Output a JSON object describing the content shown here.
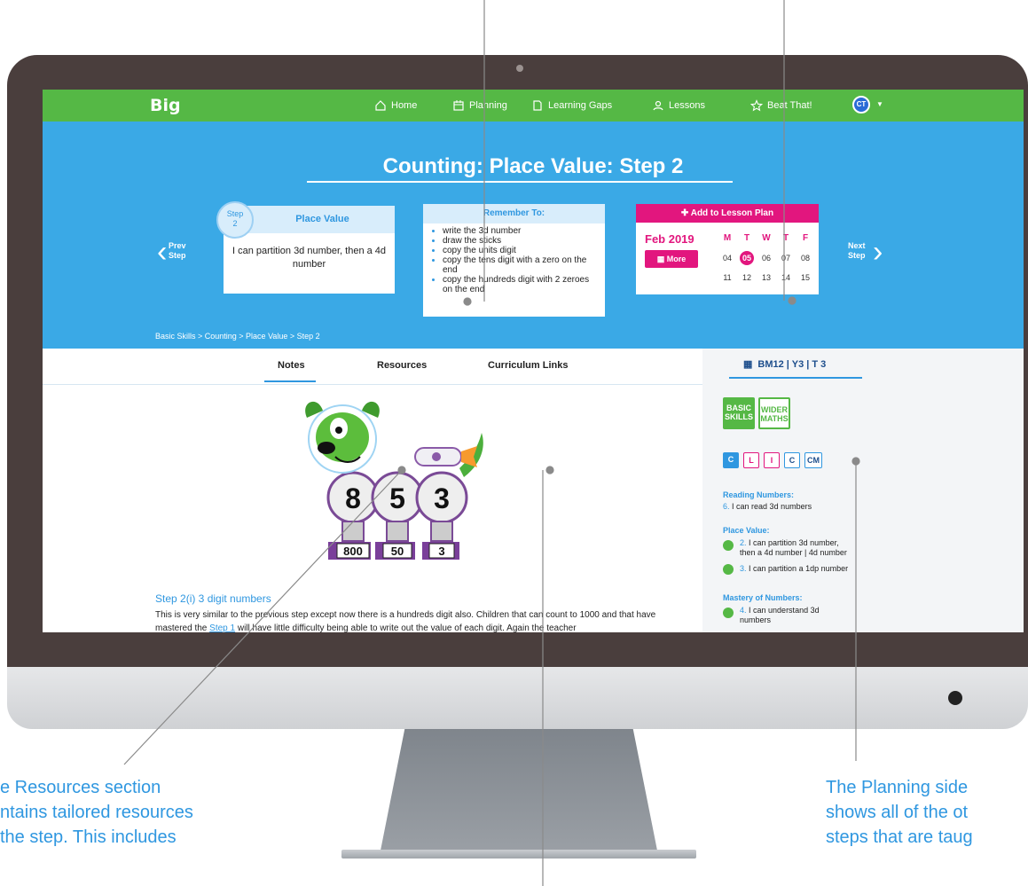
{
  "nav": {
    "logo": "Big",
    "items": [
      {
        "label": "Home",
        "icon": "home-icon"
      },
      {
        "label": "Planning",
        "icon": "calendar-icon"
      },
      {
        "label": "Learning Gaps",
        "icon": "gap-icon"
      },
      {
        "label": "Lessons",
        "icon": "user-icon"
      },
      {
        "label": "Beat That!",
        "icon": "star-icon"
      }
    ],
    "avatar": "CT"
  },
  "hero": {
    "title": "Counting: Place Value: Step 2",
    "step_card": {
      "badge_top": "Step",
      "badge_num": "2",
      "title": "Place Value",
      "text": "I can partition 3d number, then a 4d number"
    },
    "remember": {
      "title": "Remember To:",
      "items": [
        "write the 3d number",
        "draw the sticks",
        "copy the units digit",
        "copy the tens digit with a zero on the end",
        "copy the hundreds digit with 2 zeroes on the end"
      ]
    },
    "lesson_plan": {
      "title": "Add to Lesson Plan",
      "month": "Feb 2019",
      "days": [
        "M",
        "T",
        "W",
        "T",
        "F"
      ],
      "more": "More",
      "week1": [
        "04",
        "05",
        "06",
        "07",
        "08"
      ],
      "week2": [
        "11",
        "12",
        "13",
        "14",
        "15"
      ],
      "today": "05"
    },
    "prev": {
      "line1": "Prev",
      "line2": "Step"
    },
    "next": {
      "line1": "Next",
      "line2": "Step"
    },
    "breadcrumb": "Basic Skills > Counting > Place Value > Step 2"
  },
  "tabs": [
    "Notes",
    "Resources",
    "Curriculum Links"
  ],
  "content": {
    "digits": [
      "8",
      "5",
      "3"
    ],
    "values": [
      "800",
      "50",
      "3"
    ],
    "step_heading": "Step 2(i) 3 digit numbers",
    "para_part1": "This is very similar to the previous step except now there is a hundreds digit also. Children that can count to 1000 and that have mastered the ",
    "para_link": "Step 1",
    "para_part2": " will have little difficulty being able to write out the value of each digit. Again the teacher"
  },
  "sidebar": {
    "title": "BM12 | Y3 | T 3",
    "chip1": [
      "BASIC",
      "SKILLS"
    ],
    "chip2": [
      "WIDER",
      "MATHS"
    ],
    "squares": [
      "C",
      "L",
      "I",
      "C",
      "CM"
    ],
    "reading_h": "Reading Numbers:",
    "reading_num": "6.",
    "reading_t": "I can read 3d numbers",
    "pv_h": "Place Value:",
    "pv1_num": "2.",
    "pv1_a": "I can partition 3d number,",
    "pv1_b": "then a 4d number | 4d number",
    "pv2_num": "3.",
    "pv2_t": "I can partition a 1dp number",
    "mastery_h": "Mastery of Numbers:",
    "m_num": "4.",
    "m_a": "I can understand 3d",
    "m_b": "numbers"
  },
  "captions": {
    "left": [
      "e Resources section",
      "ntains tailored resources",
      " the step. This includes"
    ],
    "right": [
      "The Planning side",
      "shows all of the ot",
      "steps that are taug"
    ]
  },
  "colors": {
    "nav_green": "#55b845",
    "hero_blue": "#3aa9e6",
    "accent_pink": "#e2167e",
    "accent_blue": "#2f97e0",
    "bezel": "#4a3e3d"
  }
}
